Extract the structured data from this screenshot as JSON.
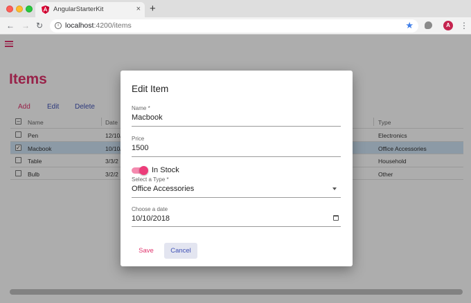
{
  "browser": {
    "tab_title": "AngularStarterKit",
    "tab_close": "×",
    "new_tab": "+",
    "url_host": "localhost",
    "url_path": ":4200/items",
    "avatar_letter": "A",
    "icons": {
      "back": "arrow-left",
      "forward": "arrow-right",
      "reload": "reload",
      "info": "info",
      "star": "star",
      "extension": "extension",
      "menu": "kebab"
    },
    "colors": {
      "star": "#3f7ee8",
      "avatar": "#c5244f"
    }
  },
  "app": {
    "title": "Items",
    "accent": "#e0336c",
    "primary": "#3f51b5",
    "actions": {
      "add": "Add",
      "edit": "Edit",
      "delete": "Delete"
    }
  },
  "table": {
    "headers": {
      "name": "Name",
      "date": "Date",
      "type": "Type"
    },
    "rows": [
      {
        "name": "Pen",
        "date": "12/10/",
        "type": "Electronics",
        "checked": false
      },
      {
        "name": "Macbook",
        "date": "10/10/",
        "type": "Office Accessories",
        "checked": true
      },
      {
        "name": "Table",
        "date": "3/3/2",
        "type": "Household",
        "checked": false
      },
      {
        "name": "Bulb",
        "date": "3/2/2",
        "type": "Other",
        "checked": false
      }
    ],
    "check_mark": "✓"
  },
  "dialog": {
    "title": "Edit Item",
    "name": {
      "label": "Name *",
      "value": "Macbook"
    },
    "price": {
      "label": "Price",
      "value": "1500"
    },
    "in_stock": {
      "label": "In Stock",
      "on": true
    },
    "type": {
      "label": "Select a Type *",
      "value": "Office Accessories"
    },
    "date": {
      "label": "Choose a date",
      "value": "10/10/2018"
    },
    "save_label": "Save",
    "cancel_label": "Cancel"
  }
}
